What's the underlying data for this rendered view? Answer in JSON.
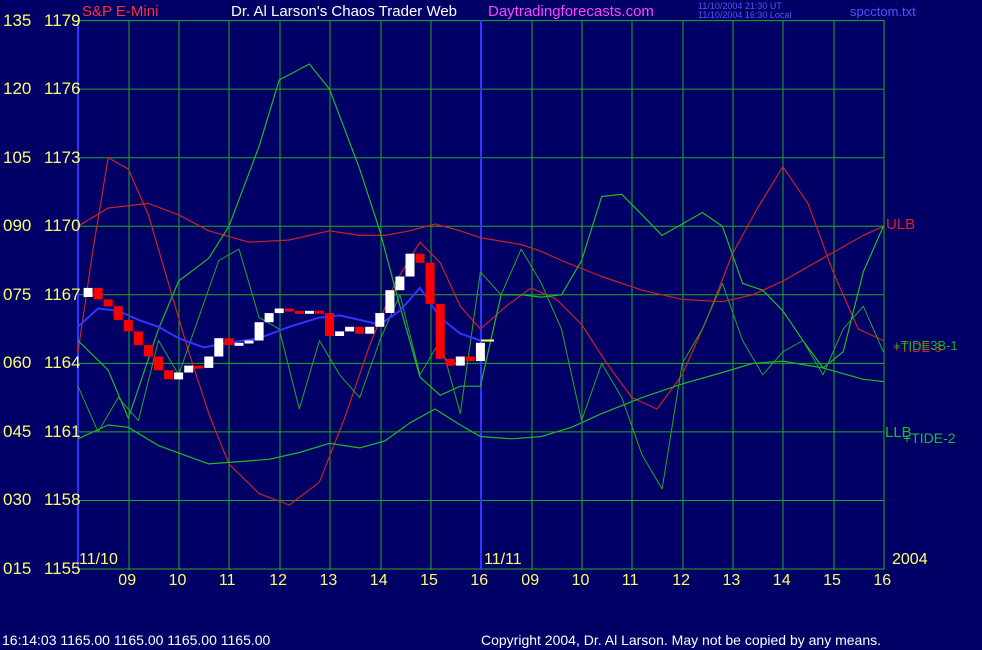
{
  "header": {
    "instrument": "S&P E-Mini",
    "title": "Dr. Al Larson's Chaos Trader Web",
    "site": "Daytradingforecasts.com",
    "stamp_utc": "11/10/2004 21:30 UT",
    "stamp_local": "11/10/2004 16:30 Local",
    "file": "spcctom.txt"
  },
  "footer": {
    "quote": "16:14:03  1165.00 1165.00 1165.00 1165.00",
    "copyright": "Copyright 2004, Dr. Al Larson. May not be copied by any means."
  },
  "colors": {
    "background": "#000066",
    "grid": "#22aa22",
    "price_up": "#ffffff",
    "price_down": "#ff0000",
    "tide": "#22aa22",
    "band_red": "#cc2222",
    "band_green": "#22bb22",
    "sma_blue": "#3333ff",
    "yellow": "#ffff66"
  },
  "chart_data": {
    "type": "line",
    "y_left_labels": [
      "135",
      "120",
      "105",
      "090",
      "075",
      "060",
      "045",
      "030",
      "015"
    ],
    "y_price_labels": [
      "1179",
      "1176",
      "1173",
      "1170",
      "1167",
      "1164",
      "1161",
      "1158",
      "1155"
    ],
    "price_ylim": [
      1155,
      1179
    ],
    "oscillator_ylim": [
      15,
      135
    ],
    "date_labels": [
      "11/10",
      "11/11"
    ],
    "year_label": "2004",
    "hour_ticks": [
      "09",
      "10",
      "11",
      "12",
      "13",
      "14",
      "15",
      "16",
      "09",
      "10",
      "11",
      "12",
      "13",
      "14",
      "15",
      "16"
    ],
    "line_labels": {
      "ulb": "ULB",
      "llb": "LLB",
      "tide_2": "+TIDE-2",
      "tide_3b_1": "+TIDE3B-1",
      "overlap": "+TIDE-3"
    },
    "last_price": 1165,
    "series": [
      {
        "name": "ULB",
        "x_hours": [
          8,
          8.6,
          9.4,
          10,
          10.6,
          11.4,
          12.2,
          13,
          13.6,
          14.1,
          14.6,
          15.1,
          15.6,
          16,
          16.8,
          17.2,
          17.6,
          18.4,
          19.2,
          20,
          20.8,
          21.4,
          22,
          22.8,
          23.6,
          24
        ],
        "values": [
          1170,
          1170.8,
          1171,
          1170.5,
          1169.8,
          1169.3,
          1169.4,
          1169.8,
          1169.6,
          1169.6,
          1169.8,
          1170.1,
          1169.8,
          1169.5,
          1169.2,
          1168.9,
          1168.5,
          1167.8,
          1167.2,
          1166.8,
          1166.7,
          1167,
          1167.6,
          1168.6,
          1169.6,
          1170
        ]
      },
      {
        "name": "LLB",
        "x_hours": [
          8,
          8.6,
          9,
          9.6,
          10.1,
          10.6,
          11.2,
          11.8,
          12.4,
          13,
          13.6,
          14.1,
          14.6,
          15.1,
          15.6,
          16,
          16.6,
          17.2,
          17.8,
          18.4,
          19.2,
          20,
          20.8,
          21.4,
          22,
          22.8,
          23.6,
          24
        ],
        "values": [
          1160.7,
          1161.3,
          1161.2,
          1160.4,
          1160,
          1159.6,
          1159.7,
          1159.8,
          1160.1,
          1160.5,
          1160.3,
          1160.6,
          1161.4,
          1162,
          1161.3,
          1160.8,
          1160.7,
          1160.8,
          1161.2,
          1161.8,
          1162.5,
          1163.1,
          1163.6,
          1164,
          1164.1,
          1163.8,
          1163.3,
          1163.2
        ]
      },
      {
        "name": "+TIDE-3",
        "x_hours": [
          8,
          8.3,
          8.6,
          9,
          9.4,
          9.8,
          10.2,
          10.6,
          11,
          11.6,
          12.2,
          12.8,
          13.3,
          13.8,
          14.3,
          14.8,
          15.2,
          15.6,
          16,
          16.5,
          17,
          17.5,
          18,
          18.5,
          19,
          19.5,
          20,
          20.5,
          21,
          21.5,
          22,
          22.5,
          23,
          23.5,
          24
        ],
        "values": [
          1164.5,
          1169,
          1173,
          1172.5,
          1170.5,
          1167.5,
          1164.5,
          1161.8,
          1159.6,
          1158.3,
          1157.8,
          1158.8,
          1161.6,
          1164.8,
          1167.5,
          1169.3,
          1168.4,
          1166.5,
          1165.5,
          1166.5,
          1167.3,
          1166.8,
          1165.7,
          1164,
          1162.5,
          1162,
          1163.5,
          1166,
          1168.8,
          1170.8,
          1172.6,
          1171,
          1168,
          1165.5,
          1165
        ]
      },
      {
        "name": "+TIDE-2",
        "x_hours": [
          8,
          8.6,
          9,
          9.6,
          10,
          10.6,
          11,
          11.6,
          12,
          12.6,
          13,
          13.6,
          14,
          14.4,
          14.8,
          15.2,
          15.6,
          16,
          16.4,
          16.8,
          17.2,
          17.6,
          18,
          18.4,
          18.8,
          19.2,
          19.6,
          20,
          20.4,
          20.8,
          21.2,
          21.6,
          22,
          22.4,
          22.8,
          23.2,
          23.6,
          24
        ],
        "values": [
          1165,
          1163.7,
          1161.6,
          1165.5,
          1167.6,
          1168.6,
          1170,
          1173.5,
          1176.4,
          1177.1,
          1176,
          1172.5,
          1169.8,
          1166.5,
          1163.4,
          1162.6,
          1163,
          1163,
          1167,
          1167,
          1166.9,
          1167,
          1168.5,
          1171.3,
          1171.4,
          1170.5,
          1169.6,
          1170.1,
          1170.6,
          1170,
          1167.5,
          1167.2,
          1166.3,
          1165,
          1163.8,
          1164.5,
          1168,
          1170
        ]
      },
      {
        "name": "+TIDE3B-1",
        "x_hours": [
          8,
          8.4,
          8.8,
          9.2,
          9.6,
          10,
          10.4,
          10.8,
          11.2,
          11.6,
          12,
          12.4,
          12.8,
          13.2,
          13.6,
          14,
          14.4,
          14.8,
          15.2,
          15.6,
          16,
          16.4,
          16.8,
          17.2,
          17.6,
          18,
          18.4,
          18.8,
          19.2,
          19.6,
          20,
          20.4,
          20.8,
          21.2,
          21.6,
          22,
          22.4,
          22.8,
          23.2,
          23.6,
          24
        ],
        "values": [
          1163,
          1161,
          1162.5,
          1161.5,
          1165,
          1163.5,
          1166,
          1168.5,
          1169,
          1166,
          1165.5,
          1162,
          1165,
          1163.5,
          1162.5,
          1165,
          1167,
          1163.5,
          1165,
          1161.8,
          1168,
          1167,
          1169,
          1167.5,
          1165.5,
          1161.5,
          1164,
          1162.5,
          1160,
          1158.5,
          1164,
          1165.5,
          1167.5,
          1165,
          1163.5,
          1164.5,
          1165,
          1163.5,
          1165.5,
          1166.5,
          1164.5
        ]
      },
      {
        "name": "SMA",
        "x_hours": [
          8,
          8.4,
          8.8,
          9.2,
          9.6,
          10,
          10.5,
          11,
          11.6,
          12.2,
          12.8,
          13.2,
          13.6,
          14,
          14.4,
          14.8,
          15.2,
          15.6,
          16
        ],
        "values": [
          1165.6,
          1166.4,
          1166.3,
          1165.9,
          1165.6,
          1165.1,
          1164.7,
          1164.9,
          1165.1,
          1165.6,
          1166,
          1166.1,
          1165.9,
          1165.7,
          1166.3,
          1167.3,
          1166,
          1165.3,
          1165
        ]
      },
      {
        "name": "Price",
        "x_hours": [
          8,
          8.2,
          8.4,
          8.6,
          8.8,
          9,
          9.2,
          9.4,
          9.6,
          9.8,
          10,
          10.2,
          10.4,
          10.6,
          10.8,
          11,
          11.2,
          11.4,
          11.6,
          11.8,
          12,
          12.2,
          12.4,
          12.6,
          12.8,
          13,
          13.2,
          13.4,
          13.6,
          13.8,
          14,
          14.2,
          14.4,
          14.6,
          14.8,
          15,
          15.2,
          15.4,
          15.6,
          15.8,
          16
        ],
        "values": [
          1166.9,
          1167.3,
          1166.8,
          1166.5,
          1165.9,
          1165.4,
          1164.8,
          1164.3,
          1163.7,
          1163.3,
          1163.6,
          1163.9,
          1163.8,
          1164.3,
          1165.1,
          1164.8,
          1164.9,
          1165,
          1165.8,
          1166.2,
          1166.4,
          1166.3,
          1166.2,
          1166.3,
          1166.2,
          1165.2,
          1165.4,
          1165.6,
          1165.3,
          1165.6,
          1166.2,
          1167.2,
          1167.8,
          1168.8,
          1168.4,
          1166.6,
          1164.2,
          1163.9,
          1164.3,
          1164.1,
          1164.9
        ]
      }
    ]
  }
}
